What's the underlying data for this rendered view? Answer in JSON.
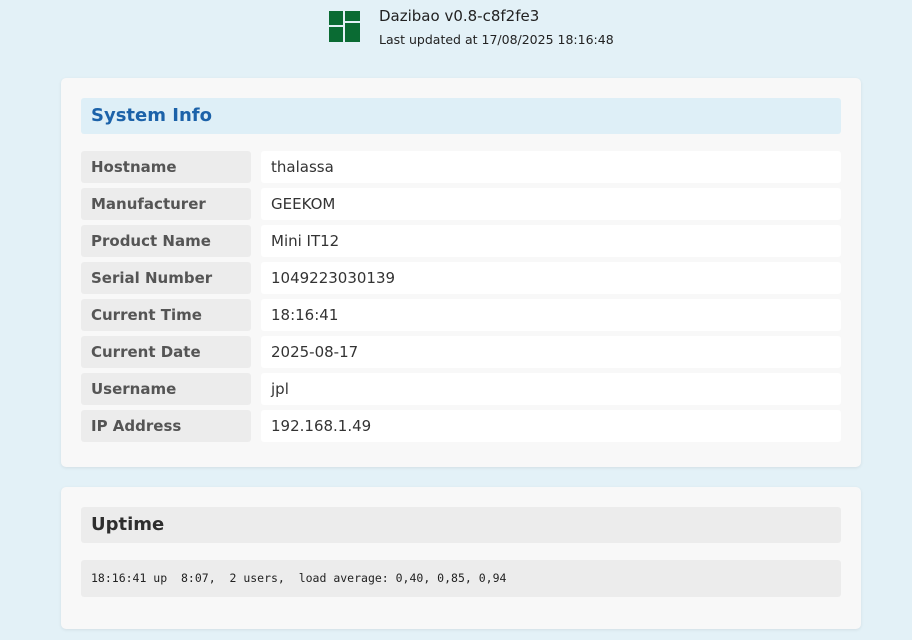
{
  "header": {
    "app_title": "Dazibao v0.8-c8f2fe3",
    "last_updated": "Last updated at 17/08/2025 18:16:48",
    "logo_icon": "dashboard-tiles-icon",
    "logo_color": "#0a6b33"
  },
  "system_info": {
    "title": "System Info",
    "rows": [
      {
        "label": "Hostname",
        "value": "thalassa"
      },
      {
        "label": "Manufacturer",
        "value": "GEEKOM"
      },
      {
        "label": "Product Name",
        "value": "Mini IT12"
      },
      {
        "label": "Serial Number",
        "value": "1049223030139"
      },
      {
        "label": "Current Time",
        "value": "18:16:41"
      },
      {
        "label": "Current Date",
        "value": "2025-08-17"
      },
      {
        "label": "Username",
        "value": "jpl"
      },
      {
        "label": "IP Address",
        "value": "192.168.1.49"
      }
    ]
  },
  "uptime": {
    "title": "Uptime",
    "output": "18:16:41 up  8:07,  2 users,  load average: 0,40, 0,85, 0,94"
  },
  "colors": {
    "page_background": "#e3f1f7",
    "section_title_accent": "#1c62a9"
  }
}
